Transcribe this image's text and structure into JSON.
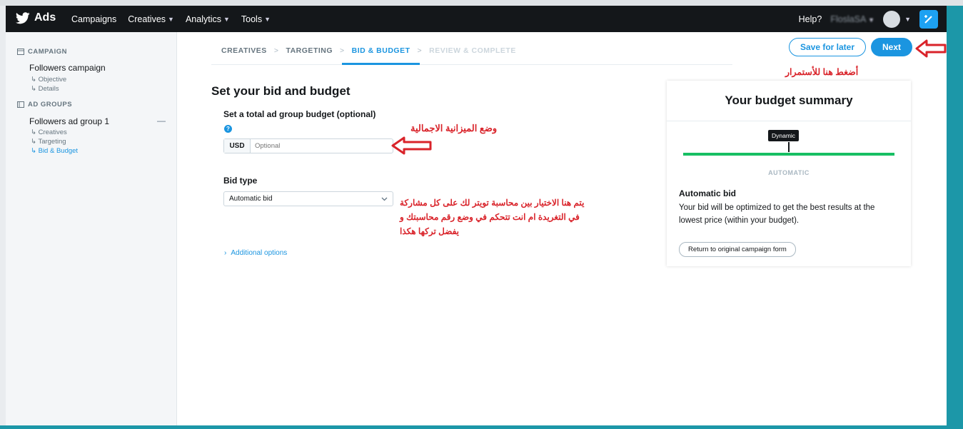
{
  "topbar": {
    "brand": "Ads",
    "nav": [
      "Campaigns",
      "Creatives",
      "Analytics",
      "Tools"
    ],
    "help": "Help?",
    "account": "FloslaSA"
  },
  "sidebar": {
    "campaign_heading": "CAMPAIGN",
    "campaign_name": "Followers campaign",
    "campaign_items": [
      "Objective",
      "Details"
    ],
    "adgroups_heading": "AD GROUPS",
    "adgroup_name": "Followers ad group 1",
    "adgroup_items": [
      "Creatives",
      "Targeting",
      "Bid & Budget"
    ],
    "adgroup_menu": "—"
  },
  "steps": {
    "items": [
      "CREATIVES",
      "TARGETING",
      "BID & BUDGET",
      "REVIEW & COMPLETE"
    ],
    "separator": ">"
  },
  "actions": {
    "save_label": "Save for later",
    "next_label": "Next"
  },
  "annotations": {
    "next": "أضغط هنا للأستمرار",
    "budget": "وضع الميزانية الاجمالية",
    "bid_line1": "يتم هنا الاختيار بين محاسبة تويتر لك على كل مشاركة",
    "bid_line2": "في التغريدة ام انت تتحكم في وضع رقم محاسبتك و",
    "bid_line3": "يفضل تركها هكذا"
  },
  "form": {
    "title": "Set your bid and budget",
    "budget_label": "Set a total ad group budget (optional)",
    "help_glyph": "?",
    "currency": "USD",
    "budget_placeholder": "Optional",
    "bid_type_label": "Bid type",
    "bid_type_value": "Automatic bid",
    "additional_options": "Additional options"
  },
  "summary": {
    "title": "Your budget summary",
    "tag": "Dynamic",
    "mode_label": "AUTOMATIC",
    "bid_title": "Automatic bid",
    "bid_desc": "Your bid will be optimized to get the best results at the lowest price (within your budget).",
    "return_label": "Return to original campaign form"
  },
  "colors": {
    "accent": "#1b95e0",
    "annotation": "#d9232a",
    "success": "#17bf63",
    "topbar": "#14171a"
  }
}
